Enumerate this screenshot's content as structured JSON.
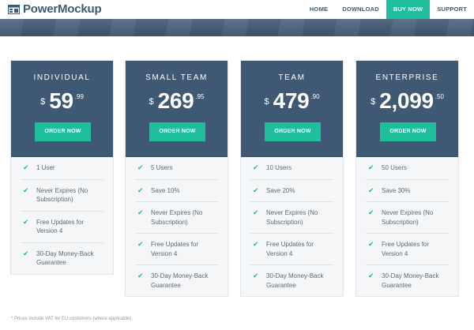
{
  "header": {
    "logo_text": "PowerMockup",
    "nav": [
      {
        "label": "HOME",
        "active": false
      },
      {
        "label": "DOWNLOAD",
        "active": false
      },
      {
        "label": "BUY NOW",
        "active": true
      },
      {
        "label": "SUPPORT",
        "active": false
      }
    ]
  },
  "plans": [
    {
      "name": "INDIVIDUAL",
      "currency": "$",
      "amount": "59",
      "cents": ".99",
      "button": "ORDER NOW",
      "features": [
        "1 User",
        "Never Expires (No Subscription)",
        "Free Updates for Version 4",
        "30-Day Money-Back Guarantee"
      ]
    },
    {
      "name": "SMALL TEAM",
      "currency": "$",
      "amount": "269",
      "cents": ".95",
      "button": "ORDER NOW",
      "features": [
        "5 Users",
        "Save 10%",
        "Never Expires (No Subscription)",
        "Free Updates for Version 4",
        "30-Day Money-Back Guarantee"
      ]
    },
    {
      "name": "TEAM",
      "currency": "$",
      "amount": "479",
      "cents": ".90",
      "button": "ORDER NOW",
      "features": [
        "10 Users",
        "Save 20%",
        "Never Expires (No Subscription)",
        "Free Updates for Version 4",
        "30-Day Money-Back Guarantee"
      ]
    },
    {
      "name": "ENTERPRISE",
      "currency": "$",
      "amount": "2,099",
      "cents": ".50",
      "button": "ORDER NOW",
      "features": [
        "50 Users",
        "Save 30%",
        "Never Expires (No Subscription)",
        "Free Updates for Version 4",
        "30-Day Money-Back Guarantee"
      ]
    }
  ],
  "footnote": "* Prices include VAT for EU customers (where applicable).",
  "colors": {
    "accent": "#1fbf9c",
    "card_header": "#3f5873",
    "brand": "#3d5a73"
  },
  "icons": {
    "logo": "window-grid-icon",
    "feature": "check-icon"
  }
}
